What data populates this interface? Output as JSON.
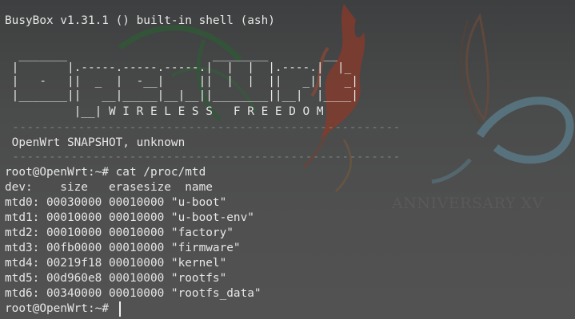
{
  "terminal": {
    "lines": [
      "BusyBox v1.31.1 () built-in shell (ash)",
      "",
      "  _______                     ________        __",
      " |       |.-----.-----.-----.|  |  |  |.----.|  |_",
      " |   -   ||  _  |  -__|     ||  |  |  ||   _||   _|",
      " |_______||   __|_____|__|__||________||__|  |____|",
      "          |__| W I R E L E S S   F R E E D O M",
      " -----------------------------------------------------",
      " OpenWrt SNAPSHOT, unknown",
      " -----------------------------------------------------",
      "root@OpenWrt:~# cat /proc/mtd",
      "dev:    size   erasesize  name",
      "mtd0: 00030000 00010000 \"u-boot\"",
      "mtd1: 00010000 00010000 \"u-boot-env\"",
      "mtd2: 00010000 00010000 \"factory\"",
      "mtd3: 00fb0000 00010000 \"firmware\"",
      "mtd4: 00219f18 00010000 \"kernel\"",
      "mtd5: 00d960e8 00010000 \"rootfs\"",
      "mtd6: 00340000 00010000 \"rootfs_data\"",
      "root@OpenWrt:~# "
    ]
  },
  "wallpaper": {
    "watermark": "ANNIVERSARY XV"
  },
  "colors": {
    "text": "#e6e6e6",
    "dashes": "#7e7e7e",
    "flame": "#8a3a2a",
    "leaf": "#2f5a36",
    "swirl": "#5c7f8e"
  }
}
